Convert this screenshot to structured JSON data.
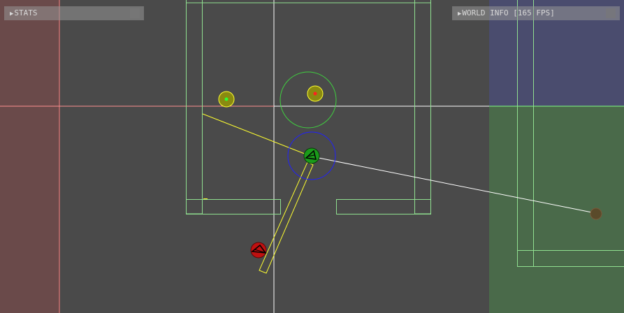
{
  "panels": {
    "stats": {
      "toggle_icon": "▶",
      "label": "STATS"
    },
    "world": {
      "toggle_icon": "▶",
      "label": "WORLD INFO [165 FPS]"
    }
  },
  "colors": {
    "background": "#4a4a4a",
    "wall_outline": "#90e090",
    "red_zone": "#6a4a4a",
    "blue_zone": "#4a4c6e",
    "green_zone": "#4a6a4a",
    "axis_red": "#ff8080",
    "axis_white": "#ffffff",
    "axis_green": "#80ff80",
    "yellow": "#ffff30",
    "blue_circle": "#2020ff",
    "green_circle": "#40d040",
    "player": "#1a9a1a",
    "enemy": "#c01010"
  },
  "icons": {
    "panel_toggle": "triangle-right-icon",
    "player": "player-icon",
    "enemy": "enemy-icon",
    "pickup": "pickup-icon"
  }
}
